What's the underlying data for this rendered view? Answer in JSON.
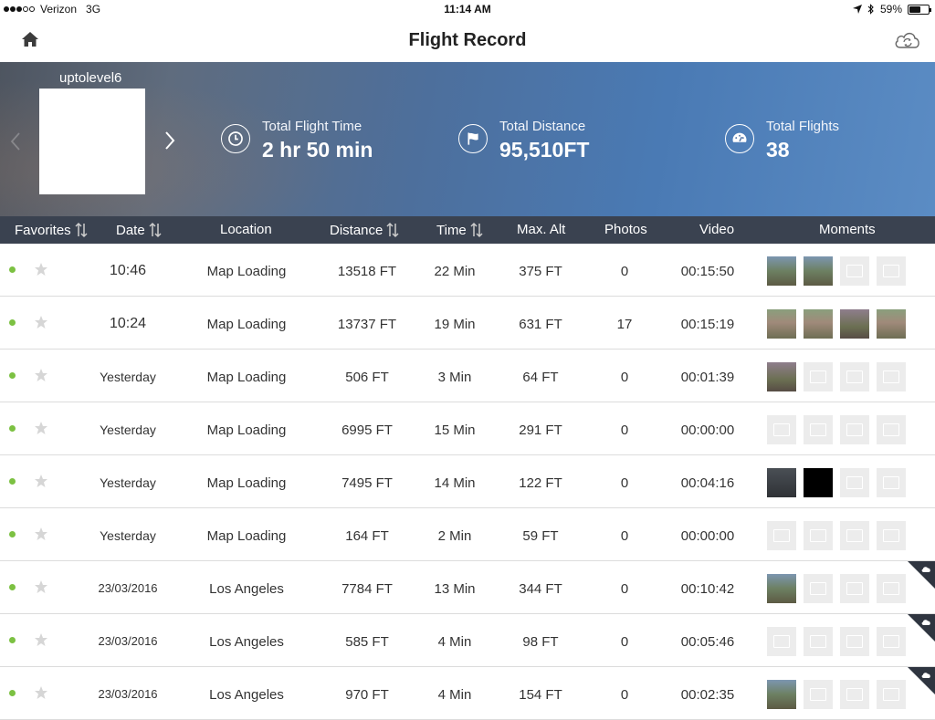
{
  "status": {
    "carrier": "Verizon",
    "network": "3G",
    "time": "11:14 AM",
    "battery": "59%",
    "battery_fraction": 0.59
  },
  "nav": {
    "title": "Flight Record",
    "home_icon": "home-icon",
    "cloud_icon": "cloud-sync-icon"
  },
  "profile": {
    "username": "uptolevel6"
  },
  "stats": {
    "flight_time": {
      "label": "Total Flight Time",
      "value": "2 hr 50 min"
    },
    "distance": {
      "label": "Total Distance",
      "value": "95,510FT"
    },
    "flights": {
      "label": "Total Flights",
      "value": "38"
    }
  },
  "columns": {
    "favorites": "Favorites",
    "date": "Date",
    "location": "Location",
    "distance": "Distance",
    "time": "Time",
    "max_alt": "Max. Alt",
    "photos": "Photos",
    "video": "Video",
    "moments": "Moments"
  },
  "rows": [
    {
      "date": "10:46",
      "location": "Map Loading",
      "distance": "13518 FT",
      "time": "22 Min",
      "max_alt": "375 FT",
      "photos": "0",
      "video": "00:15:50"
    },
    {
      "date": "10:24",
      "location": "Map Loading",
      "distance": "13737 FT",
      "time": "19 Min",
      "max_alt": "631 FT",
      "photos": "17",
      "video": "00:15:19"
    },
    {
      "date": "Yesterday",
      "location": "Map Loading",
      "distance": "506 FT",
      "time": "3 Min",
      "max_alt": "64 FT",
      "photos": "0",
      "video": "00:01:39"
    },
    {
      "date": "Yesterday",
      "location": "Map Loading",
      "distance": "6995 FT",
      "time": "15 Min",
      "max_alt": "291 FT",
      "photos": "0",
      "video": "00:00:00"
    },
    {
      "date": "Yesterday",
      "location": "Map Loading",
      "distance": "7495 FT",
      "time": "14 Min",
      "max_alt": "122 FT",
      "photos": "0",
      "video": "00:04:16"
    },
    {
      "date": "Yesterday",
      "location": "Map Loading",
      "distance": "164 FT",
      "time": "2 Min",
      "max_alt": "59 FT",
      "photos": "0",
      "video": "00:00:00"
    },
    {
      "date": "23/03/2016",
      "location": "Los Angeles",
      "distance": "7784 FT",
      "time": "13 Min",
      "max_alt": "344 FT",
      "photos": "0",
      "video": "00:10:42"
    },
    {
      "date": "23/03/2016",
      "location": "Los Angeles",
      "distance": "585 FT",
      "time": "4 Min",
      "max_alt": "98 FT",
      "photos": "0",
      "video": "00:05:46"
    },
    {
      "date": "23/03/2016",
      "location": "Los Angeles",
      "distance": "970 FT",
      "time": "4 Min",
      "max_alt": "154 FT",
      "photos": "0",
      "video": "00:02:35"
    }
  ],
  "colors": {
    "header_bg": "#3a4250",
    "status_dot": "#7cc142"
  }
}
